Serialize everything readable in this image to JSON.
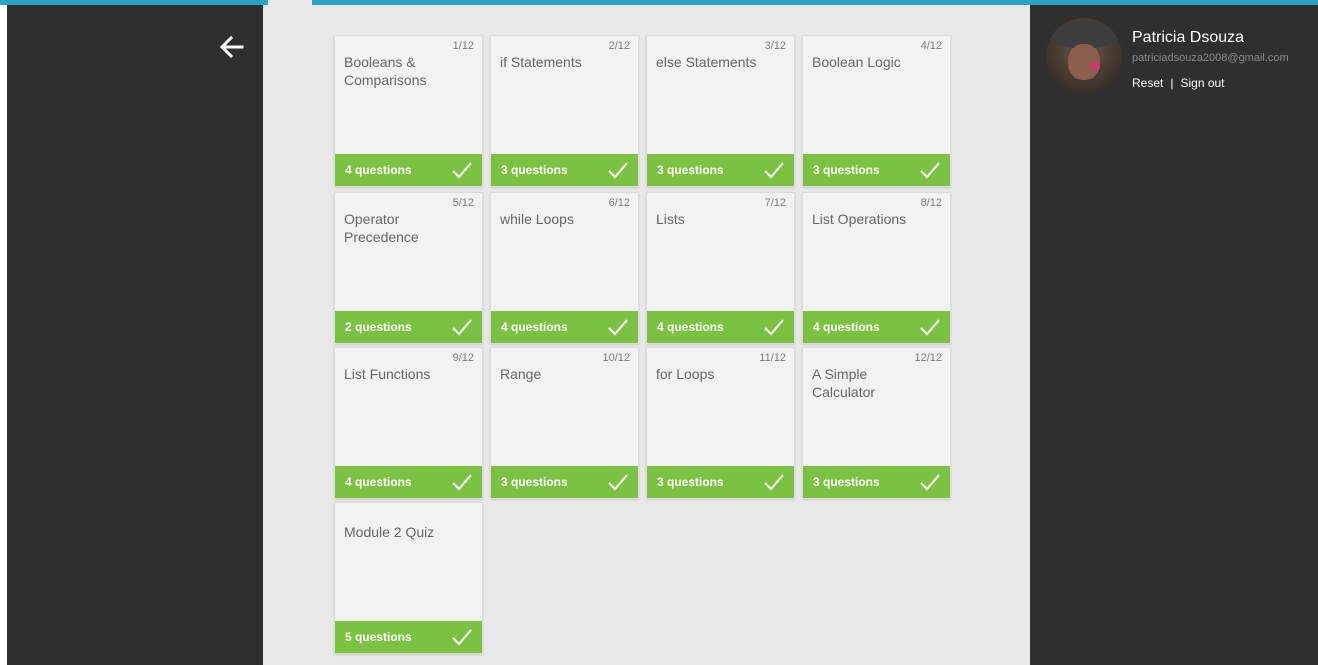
{
  "user": {
    "name": "Patricia Dsouza",
    "email": "patriciadsouza2008@gmail.com",
    "reset_label": "Reset",
    "separator": "|",
    "signout_label": "Sign out"
  },
  "lessons": [
    {
      "num": "1/12",
      "title": "Booleans & Comparisons",
      "questions": "4 questions"
    },
    {
      "num": "2/12",
      "title": "if Statements",
      "questions": "3 questions"
    },
    {
      "num": "3/12",
      "title": "else Statements",
      "questions": "3 questions"
    },
    {
      "num": "4/12",
      "title": "Boolean Logic",
      "questions": "3 questions"
    },
    {
      "num": "5/12",
      "title": "Operator Precedence",
      "questions": "2 questions"
    },
    {
      "num": "6/12",
      "title": "while Loops",
      "questions": "4 questions"
    },
    {
      "num": "7/12",
      "title": "Lists",
      "questions": "4 questions"
    },
    {
      "num": "8/12",
      "title": "List Operations",
      "questions": "4 questions"
    },
    {
      "num": "9/12",
      "title": "List Functions",
      "questions": "4 questions"
    },
    {
      "num": "10/12",
      "title": "Range",
      "questions": "3 questions"
    },
    {
      "num": "11/12",
      "title": "for Loops",
      "questions": "3 questions"
    },
    {
      "num": "12/12",
      "title": "A Simple Calculator",
      "questions": "3 questions"
    },
    {
      "num": "",
      "title": "Module 2 Quiz",
      "questions": "5 questions"
    }
  ],
  "icons": {
    "back": "arrow-left-icon",
    "completed": "checkmark-icon"
  },
  "colors": {
    "accent_green": "#7cc242",
    "top_bar": "#2ba3c9",
    "dark_panel": "#2f2f2f",
    "content_bg": "#e8e8e8"
  }
}
